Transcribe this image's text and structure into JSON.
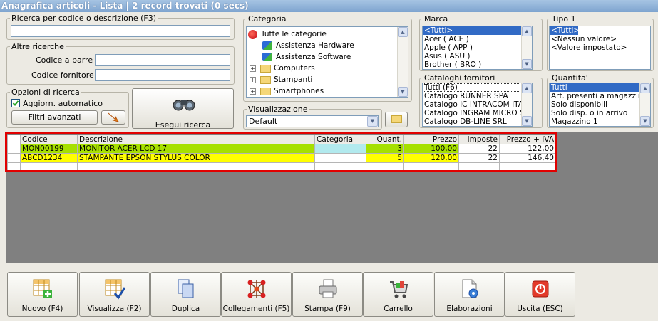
{
  "window": {
    "title": "Anagrafica articoli  - Lista | 2 record trovati (0 secs)"
  },
  "search": {
    "legend": "Ricerca per codice o descrizione (F3)",
    "value": ""
  },
  "other_search": {
    "legend": "Altre ricerche",
    "barcode_label": "Codice a barre :",
    "barcode_value": "",
    "supplier_code_label": "Codice fornitore :",
    "supplier_code_value": ""
  },
  "search_options": {
    "legend": "Opzioni di ricerca",
    "auto_update_label": "Aggiorn. automatico",
    "auto_update_checked": true,
    "advanced_filters_label": "Filtri avanzati"
  },
  "execute_search_label": "Esegui ricerca",
  "category": {
    "legend": "Categoria",
    "items": [
      {
        "label": "Tutte le categorie",
        "kind": "root"
      },
      {
        "label": "Assistenza Hardware",
        "kind": "leaf"
      },
      {
        "label": "Assistenza Software",
        "kind": "leaf"
      },
      {
        "label": "Computers",
        "kind": "folder"
      },
      {
        "label": "Stampanti",
        "kind": "folder"
      },
      {
        "label": "Smartphones",
        "kind": "folder"
      }
    ]
  },
  "view": {
    "legend": "Visualizzazione",
    "selected": "Default"
  },
  "brand": {
    "legend": "Marca",
    "items": [
      "<Tutti>",
      "Acer ( ACE )",
      "Apple ( APP )",
      "Asus ( ASU )",
      "Brother ( BRO )"
    ],
    "selected_index": 0
  },
  "type1": {
    "legend": "Tipo 1",
    "items": [
      "<Tutti>",
      "<Nessun valore>",
      "<Valore impostato>"
    ],
    "selected_index": 0
  },
  "supplier_catalogs": {
    "legend": "Cataloghi fornitori",
    "items": [
      "Tutti (F6)",
      "Catalogo RUNNER SPA",
      "Catalogo IC INTRACOM ITAL",
      "Catalogo INGRAM MICRO SRL",
      "Catalogo DB-LINE SRL"
    ],
    "selected_index": 0
  },
  "quantity": {
    "legend": "Quantita'",
    "items": [
      "Tutti",
      "Art. presenti a magazzino",
      "Solo disponibili",
      "Solo disp. o in arrivo",
      "Magazzino 1"
    ],
    "selected_index": 0
  },
  "grid": {
    "columns": [
      "Codice",
      "Descrizione",
      "Categoria",
      "Quant.",
      "Prezzo",
      "Imposte",
      "Prezzo + IVA"
    ],
    "rows": [
      {
        "codice": "MON00199",
        "descrizione": "MONITOR ACER LCD 17",
        "categoria": "",
        "quant": "3",
        "prezzo": "100,00",
        "imposte": "22",
        "prezzo_iva": "122,00",
        "color": "#a6e000"
      },
      {
        "codice": "ABCD1234",
        "descrizione": "STAMPANTE EPSON STYLUS COLOR",
        "categoria": "",
        "quant": "5",
        "prezzo": "120,00",
        "imposte": "22",
        "prezzo_iva": "146,40",
        "color": "#ffff00"
      }
    ]
  },
  "toolbar": {
    "buttons": [
      {
        "label": "Nuovo (F4)",
        "icon": "new-grid-icon"
      },
      {
        "label": "Visualizza (F2)",
        "icon": "view-grid-icon"
      },
      {
        "label": "Duplica",
        "icon": "duplicate-icon"
      },
      {
        "label": "Collegamenti (F5)",
        "icon": "links-icon"
      },
      {
        "label": "Stampa (F9)",
        "icon": "printer-icon"
      },
      {
        "label": "Carrello",
        "icon": "cart-icon"
      },
      {
        "label": "Elaborazioni",
        "icon": "processing-icon"
      },
      {
        "label": "Uscita (ESC)",
        "icon": "exit-icon"
      }
    ]
  }
}
